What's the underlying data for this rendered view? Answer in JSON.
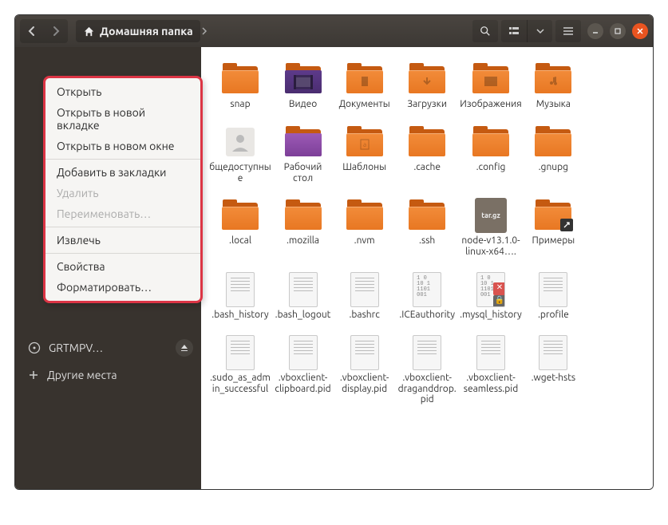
{
  "header": {
    "path_label": "Домашняя папка"
  },
  "context_menu": {
    "open": "Открыть",
    "open_tab": "Открыть в новой вкладке",
    "open_window": "Открыть в новом окне",
    "bookmark": "Добавить в закладки",
    "delete": "Удалить",
    "rename": "Переименовать…",
    "eject": "Извлечь",
    "properties": "Свойства",
    "format": "Форматировать…"
  },
  "sidebar": {
    "device": "GRTMPV…",
    "other": "Другие места"
  },
  "files": {
    "snap": "snap",
    "video": "Видео",
    "documents": "Документы",
    "downloads": "Загрузки",
    "pictures": "Изображения",
    "music": "Музыка",
    "public": "бщедоступные",
    "desktop": "Рабочий стол",
    "templates": "Шаблоны",
    "cache": ".cache",
    "config": ".config",
    "gnupg": ".gnupg",
    "local": ".local",
    "mozilla": ".mozilla",
    "nvm": ".nvm",
    "ssh": ".ssh",
    "node": "node-v13.1.0-linux-x64….",
    "targz_label": "tar.gz",
    "examples": "Примеры",
    "bash_history": ".bash_history",
    "bash_logout": ".bash_logout",
    "bashrc": ".bashrc",
    "iceauthority": ".ICEauthority",
    "mysql_history": ".mysql_history",
    "profile": ".profile",
    "sudo": ".sudo_as_admin_successful",
    "vbox_client": ".vboxclient-clipboard.pid",
    "vbox_display": ".vboxclient-display.pid",
    "vbox_dnd": ".vboxclient-draganddrop.pid",
    "vbox_seamless": ".vboxclient-seamless.pid",
    "wget_hsts": ".wget-hsts"
  }
}
